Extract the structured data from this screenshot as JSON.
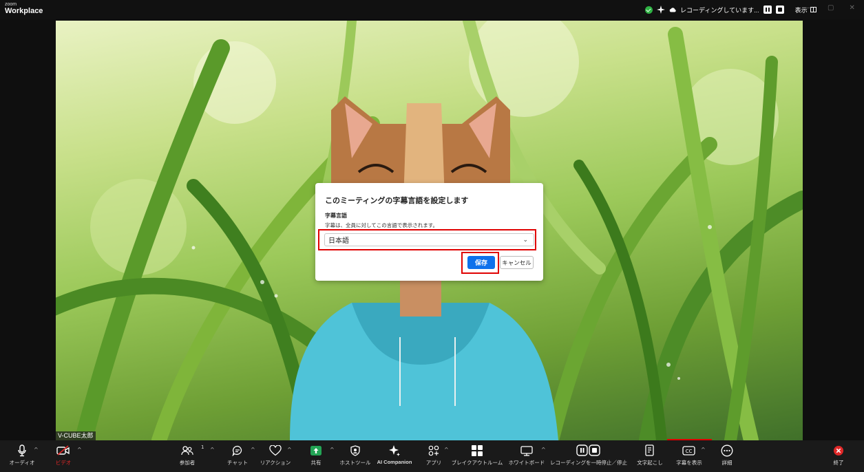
{
  "titlebar": {
    "logo_small": "zoom",
    "logo_big": "Workplace",
    "recording_text": "レコーディングしています...",
    "view_label": "表示"
  },
  "video": {
    "participant_name": "V-CUBE太郎"
  },
  "dialog": {
    "title": "このミーティングの字幕言語を設定します",
    "section_label": "字幕言語",
    "description": "字幕は、全員に対してこの言語で表示されます。",
    "selected_language": "日本語",
    "save_label": "保存",
    "cancel_label": "キャンセル"
  },
  "toolbar": {
    "audio": "オーディオ",
    "video": "ビデオ",
    "participants": "参加者",
    "participants_count": "1",
    "chat": "チャット",
    "reactions": "リアクション",
    "share": "共有",
    "host_tools": "ホストツール",
    "ai_companion": "AI Companion",
    "apps": "アプリ",
    "breakout": "ブレイクアウトルーム",
    "whiteboard": "ホワイトボード",
    "recording": "レコーディングを一時停止／停止",
    "transcript": "文字起こし",
    "captions": "字幕を表示",
    "more": "詳細",
    "end": "終了"
  },
  "colors": {
    "accent_blue": "#0e71eb",
    "highlight_red": "#e00000",
    "share_green": "#23a455",
    "end_red": "#e02828"
  }
}
